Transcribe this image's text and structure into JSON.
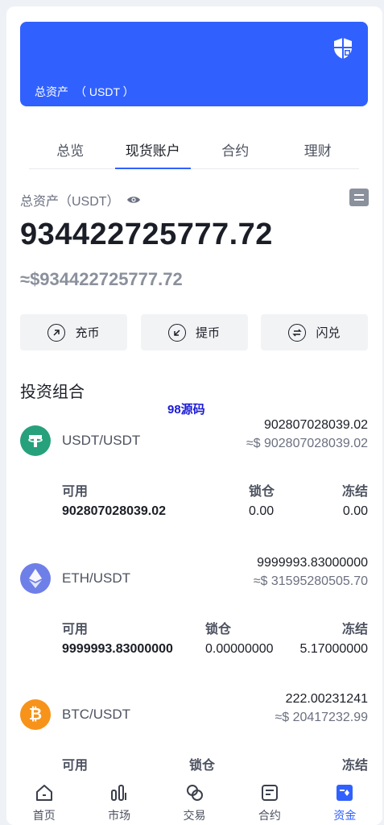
{
  "hero": {
    "label": "总资产",
    "unit": "（ USDT ）"
  },
  "tabs": [
    "总览",
    "现货账户",
    "合约",
    "理财"
  ],
  "balance": {
    "label": "总资产（USDT）",
    "value": "934422725777.72",
    "usd": "≈$934422725777.72"
  },
  "actions": {
    "deposit": "充币",
    "withdraw": "提币",
    "swap": "闪兑"
  },
  "portfolio_title": "投资组合",
  "watermark": "98源码",
  "assets": [
    {
      "pair": "USDT/USDT",
      "amount": "902807028039.02",
      "usd": "≈$ 902807028039.02",
      "headers": [
        "可用",
        "锁仓",
        "冻结"
      ],
      "values": [
        "902807028039.02",
        "0.00",
        "0.00"
      ],
      "color": "#26a17b",
      "icon": "tether-icon"
    },
    {
      "pair": "ETH/USDT",
      "amount": "9999993.83000000",
      "usd": "≈$ 31595280505.70",
      "headers": [
        "可用",
        "锁仓",
        "冻结"
      ],
      "values": [
        "9999993.83000000",
        "0.00000000",
        "5.17000000"
      ],
      "color": "#6f7fe8",
      "icon": "ethereum-icon"
    },
    {
      "pair": "BTC/USDT",
      "amount": "222.00231241",
      "usd": "≈$ 20417232.99",
      "headers": [
        "可用",
        "锁仓",
        "冻结"
      ],
      "color": "#f7931a",
      "icon": "bitcoin-icon"
    }
  ],
  "nav": [
    "首页",
    "市场",
    "交易",
    "合约",
    "资金"
  ],
  "accent": "#3061ff"
}
